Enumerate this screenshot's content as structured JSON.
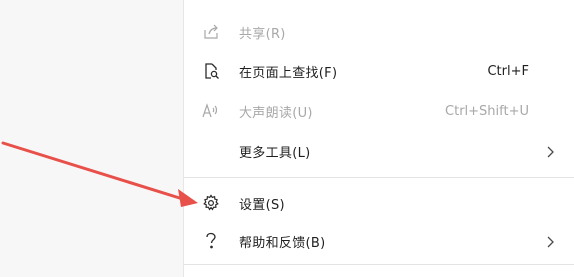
{
  "menu": {
    "items": [
      {
        "label": "共享(R)",
        "shortcut": "",
        "icon": "share-icon",
        "disabled": true,
        "submenu": false
      },
      {
        "label": "在页面上查找(F)",
        "shortcut": "Ctrl+F",
        "icon": "find-on-page-icon",
        "disabled": false,
        "submenu": false
      },
      {
        "label": "大声朗读(U)",
        "shortcut": "Ctrl+Shift+U",
        "icon": "read-aloud-icon",
        "disabled": true,
        "submenu": false
      },
      {
        "label": "更多工具(L)",
        "shortcut": "",
        "icon": "",
        "disabled": false,
        "submenu": true
      },
      {
        "label": "设置(S)",
        "shortcut": "",
        "icon": "gear-icon",
        "disabled": false,
        "submenu": false
      },
      {
        "label": "帮助和反馈(B)",
        "shortcut": "",
        "icon": "question-icon",
        "disabled": false,
        "submenu": true
      }
    ]
  },
  "annotation": {
    "arrow_color": "#e8504a",
    "points_to": "设置(S)"
  },
  "colors": {
    "menu_bg": "#ffffff",
    "disabled_text": "#a8a8a8",
    "text": "#1f1f1f"
  }
}
